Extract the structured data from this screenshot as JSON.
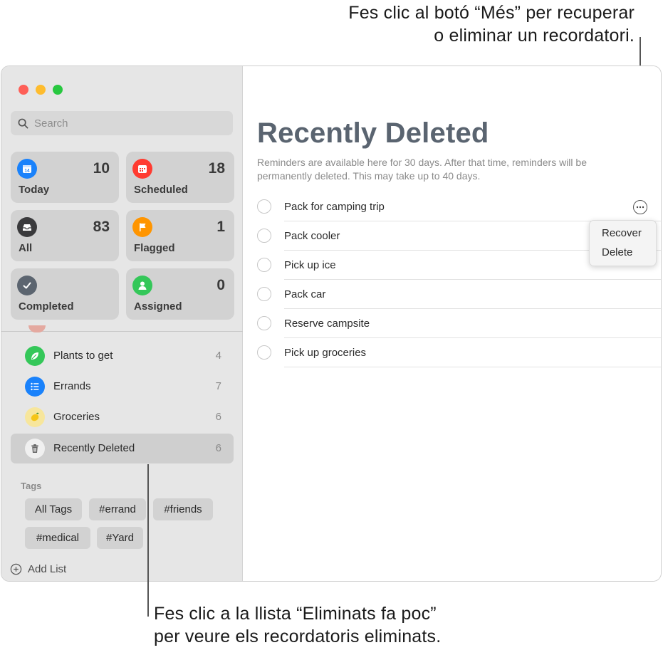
{
  "callouts": {
    "top_line1": "Fes clic al botó “Més” per recuperar",
    "top_line2": "o eliminar un recordatori.",
    "bottom_line1": "Fes clic a la llista “Eliminats fa poc”",
    "bottom_line2": "per veure els recordatoris eliminats."
  },
  "sidebar": {
    "search_placeholder": "Search",
    "smart_lists": [
      {
        "label": "Today",
        "count": "10",
        "icon": "calendar-today-icon",
        "icon_text": "14",
        "color": "#1a82fb"
      },
      {
        "label": "Scheduled",
        "count": "18",
        "icon": "calendar-icon",
        "color": "#ff3b30"
      },
      {
        "label": "All",
        "count": "83",
        "icon": "tray-icon",
        "color": "#3a3a3c"
      },
      {
        "label": "Flagged",
        "count": "1",
        "icon": "flag-icon",
        "color": "#ff9500"
      },
      {
        "label": "Completed",
        "count": "",
        "icon": "checkmark-icon",
        "color": "#5c6570"
      },
      {
        "label": "Assigned",
        "count": "0",
        "icon": "person-icon",
        "color": "#34c759"
      }
    ],
    "lists": [
      {
        "name": "Plants to get",
        "count": "4",
        "icon": "leaf-icon",
        "color": "#34c759"
      },
      {
        "name": "Errands",
        "count": "7",
        "icon": "list-bullet-icon",
        "color": "#1a82fb"
      },
      {
        "name": "Groceries",
        "count": "6",
        "icon": "lemon-icon",
        "color": "#f7e69c"
      },
      {
        "name": "Recently Deleted",
        "count": "6",
        "icon": "trash-icon",
        "color": "#f0f0f0"
      }
    ],
    "tags_title": "Tags",
    "tags": [
      "All Tags",
      "#errand",
      "#friends",
      "#medical",
      "#Yard"
    ],
    "add_list_label": "Add List"
  },
  "main": {
    "title": "Recently Deleted",
    "description": "Reminders are available here for 30 days. After that time, reminders will be permanently deleted. This may take up to 40 days.",
    "reminders": [
      "Pack for camping trip",
      "Pack cooler",
      "Pick up ice",
      "Pack car",
      "Reserve campsite",
      "Pick up groceries"
    ],
    "menu": {
      "recover": "Recover",
      "delete": "Delete"
    }
  }
}
